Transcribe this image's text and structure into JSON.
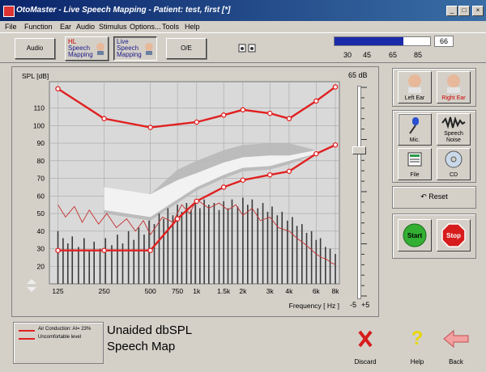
{
  "window": {
    "title": "OtoMaster - Live Speech Mapping - Patient: test, first [*]"
  },
  "menu": [
    "File",
    "Function",
    "Ear",
    "Audio",
    "Stimulus",
    "Options...",
    "Tools",
    "Help"
  ],
  "toolbar": {
    "audio": "Audio",
    "hl_speech": [
      "HL",
      "Speech",
      "Mapping"
    ],
    "live_speech": [
      "Live",
      "Speech",
      "Mapping"
    ],
    "oe": "O/E",
    "level_value": "66",
    "level_ticks": [
      "30",
      "45",
      "65",
      "85"
    ],
    "level_fill": 0.72
  },
  "chart_data": {
    "type": "line",
    "title": "Unaided dbSPL Speech Map",
    "ylabel": "SPL [dB]",
    "xlabel": "Frequency [ Hz ]",
    "x_scale": "log",
    "xlim": [
      110,
      8500
    ],
    "ylim": [
      10,
      125
    ],
    "x_ticks": [
      {
        "f": 125,
        "label": "125"
      },
      {
        "f": 250,
        "label": "250"
      },
      {
        "f": 500,
        "label": "500"
      },
      {
        "f": 750,
        "label": "750"
      },
      {
        "f": 1000,
        "label": "1k"
      },
      {
        "f": 1500,
        "label": "1.5k"
      },
      {
        "f": 2000,
        "label": "2k"
      },
      {
        "f": 3000,
        "label": "3k"
      },
      {
        "f": 4000,
        "label": "4k"
      },
      {
        "f": 6000,
        "label": "6k"
      },
      {
        "f": 8000,
        "label": "8k"
      }
    ],
    "y_ticks": [
      20,
      30,
      40,
      50,
      60,
      70,
      80,
      90,
      100,
      110
    ],
    "grid": true,
    "series": [
      {
        "name": "Uncomfortable level",
        "color": "#e02020",
        "points": [
          [
            125,
            121
          ],
          [
            250,
            104
          ],
          [
            500,
            99
          ],
          [
            1000,
            102
          ],
          [
            1500,
            106
          ],
          [
            2000,
            109
          ],
          [
            3000,
            107
          ],
          [
            4000,
            104
          ],
          [
            6000,
            114
          ],
          [
            8000,
            122
          ]
        ]
      },
      {
        "name": "Air Conduction: AI= 23%",
        "color": "#e02020",
        "points": [
          [
            125,
            29
          ],
          [
            250,
            29
          ],
          [
            500,
            29
          ],
          [
            750,
            47
          ],
          [
            1000,
            57
          ],
          [
            1500,
            65
          ],
          [
            2000,
            69
          ],
          [
            3000,
            72
          ],
          [
            4000,
            74
          ],
          [
            6000,
            84
          ],
          [
            8000,
            89
          ]
        ]
      }
    ],
    "speech_band_outer": {
      "upper": [
        [
          250,
          65
        ],
        [
          500,
          61
        ],
        [
          750,
          75
        ],
        [
          1000,
          80
        ],
        [
          1500,
          86
        ],
        [
          2000,
          89
        ],
        [
          3000,
          90
        ],
        [
          4000,
          90
        ],
        [
          6000,
          86
        ]
      ],
      "lower": [
        [
          250,
          50
        ],
        [
          500,
          46
        ],
        [
          750,
          56
        ],
        [
          1000,
          63
        ],
        [
          1500,
          70
        ],
        [
          2000,
          74
        ],
        [
          3000,
          75
        ],
        [
          4000,
          78
        ],
        [
          6000,
          84
        ]
      ]
    },
    "speech_band_inner": {
      "upper": [
        [
          250,
          65
        ],
        [
          500,
          61
        ],
        [
          750,
          69
        ],
        [
          1000,
          73
        ],
        [
          1500,
          79
        ],
        [
          2000,
          82
        ],
        [
          3000,
          83
        ],
        [
          4000,
          83
        ],
        [
          6000,
          86
        ]
      ],
      "lower": [
        [
          250,
          52
        ],
        [
          500,
          48
        ],
        [
          750,
          58
        ],
        [
          1000,
          65
        ],
        [
          1500,
          72
        ],
        [
          2000,
          76
        ],
        [
          3000,
          77
        ],
        [
          4000,
          80
        ],
        [
          6000,
          84
        ]
      ]
    },
    "live_speech_envelope": [
      [
        125,
        55
      ],
      [
        140,
        48
      ],
      [
        160,
        54
      ],
      [
        180,
        45
      ],
      [
        200,
        52
      ],
      [
        230,
        44
      ],
      [
        260,
        50
      ],
      [
        300,
        42
      ],
      [
        350,
        47
      ],
      [
        400,
        40
      ],
      [
        450,
        46
      ],
      [
        500,
        38
      ],
      [
        600,
        48
      ],
      [
        700,
        45
      ],
      [
        800,
        55
      ],
      [
        900,
        50
      ],
      [
        1000,
        58
      ],
      [
        1200,
        53
      ],
      [
        1400,
        56
      ],
      [
        1600,
        52
      ],
      [
        1800,
        55
      ],
      [
        2000,
        49
      ],
      [
        2300,
        53
      ],
      [
        2600,
        46
      ],
      [
        3000,
        48
      ],
      [
        3400,
        42
      ],
      [
        4000,
        40
      ],
      [
        4500,
        36
      ],
      [
        5000,
        33
      ],
      [
        5500,
        30
      ],
      [
        6000,
        27
      ],
      [
        6500,
        25
      ],
      [
        7000,
        24
      ],
      [
        7500,
        22
      ],
      [
        8000,
        21
      ]
    ],
    "live_speech_bars": [
      [
        125,
        40
      ],
      [
        135,
        36
      ],
      [
        145,
        33
      ],
      [
        155,
        37
      ],
      [
        170,
        31
      ],
      [
        185,
        36
      ],
      [
        200,
        29
      ],
      [
        215,
        34
      ],
      [
        235,
        30
      ],
      [
        255,
        36
      ],
      [
        280,
        32
      ],
      [
        305,
        38
      ],
      [
        330,
        33
      ],
      [
        360,
        40
      ],
      [
        390,
        35
      ],
      [
        420,
        42
      ],
      [
        455,
        38
      ],
      [
        490,
        46
      ],
      [
        530,
        44
      ],
      [
        570,
        50
      ],
      [
        610,
        47
      ],
      [
        650,
        53
      ],
      [
        700,
        49
      ],
      [
        750,
        55
      ],
      [
        800,
        51
      ],
      [
        860,
        56
      ],
      [
        920,
        52
      ],
      [
        980,
        57
      ],
      [
        1050,
        53
      ],
      [
        1120,
        58
      ],
      [
        1200,
        55
      ],
      [
        1300,
        56
      ],
      [
        1400,
        52
      ],
      [
        1500,
        57
      ],
      [
        1600,
        53
      ],
      [
        1700,
        58
      ],
      [
        1850,
        54
      ],
      [
        2000,
        59
      ],
      [
        2150,
        55
      ],
      [
        2300,
        58
      ],
      [
        2500,
        53
      ],
      [
        2700,
        56
      ],
      [
        2900,
        51
      ],
      [
        3100,
        54
      ],
      [
        3350,
        49
      ],
      [
        3600,
        51
      ],
      [
        3900,
        46
      ],
      [
        4200,
        48
      ],
      [
        4500,
        43
      ],
      [
        4850,
        44
      ],
      [
        5200,
        39
      ],
      [
        5600,
        40
      ],
      [
        6000,
        35
      ],
      [
        6400,
        36
      ],
      [
        6900,
        31
      ],
      [
        7400,
        30
      ],
      [
        8000,
        27
      ]
    ],
    "legend": [
      {
        "label": "Air Conduction: AI= 23%",
        "color": "#e02020"
      },
      {
        "label": "Uncomfortable level",
        "color": "#e02020"
      }
    ]
  },
  "level_slider": {
    "top_label": "65 dB",
    "bottom_left": "-5",
    "bottom_right": "+5",
    "value_fraction": 0.3
  },
  "right_panel": {
    "left_ear": "Left Ear",
    "right_ear": "Right Ear",
    "mic": "Mic.",
    "speech_noise": [
      "Speech",
      "Noise"
    ],
    "file": "File",
    "cd": "CD",
    "reset": "Reset",
    "start": "Start",
    "stop": "Stop"
  },
  "caption": {
    "line1": "Unaided dbSPL",
    "line2": "Speech Map"
  },
  "bottom": {
    "discard": "Discard",
    "help": "Help",
    "back": "Back"
  },
  "colors": {
    "curve": "#e02020",
    "band_light": "#f2f2f2",
    "band_dark": "#b8b8b8",
    "bars": "#3a3a3a",
    "start": "#33b033",
    "stop": "#d61c1c"
  }
}
